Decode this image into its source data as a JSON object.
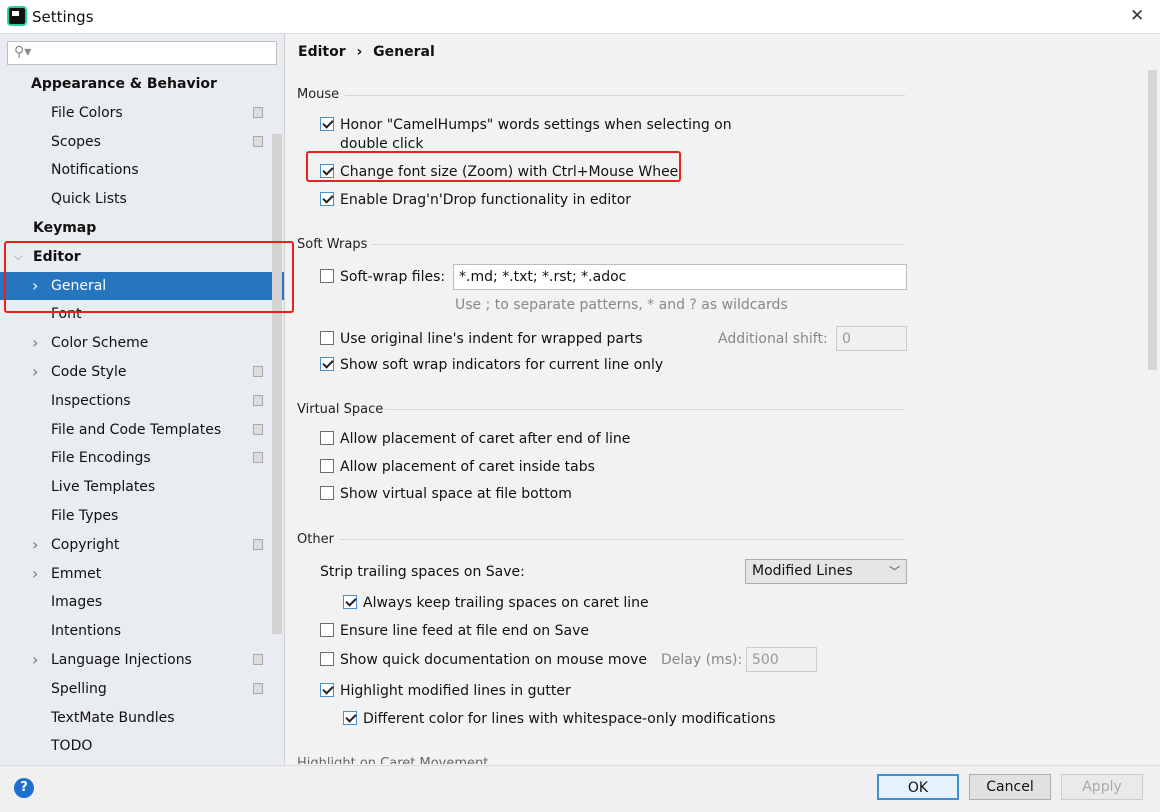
{
  "window": {
    "title": "Settings",
    "close_label": "✕"
  },
  "search": {
    "placeholder": ""
  },
  "sidebar": {
    "items": [
      {
        "label": "Appearance & Behavior",
        "level": 0,
        "bold": true
      },
      {
        "label": "File Colors",
        "level": 1,
        "copy": true
      },
      {
        "label": "Scopes",
        "level": 1,
        "copy": true
      },
      {
        "label": "Notifications",
        "level": 1
      },
      {
        "label": "Quick Lists",
        "level": 1
      },
      {
        "label": "Keymap",
        "level": 0,
        "bold": true
      },
      {
        "label": "Editor",
        "level": 0,
        "bold": true,
        "expanded": true
      },
      {
        "label": "General",
        "level": 1,
        "selected": true,
        "chevron": true
      },
      {
        "label": "Font",
        "level": 1
      },
      {
        "label": "Color Scheme",
        "level": 1,
        "chevron": true
      },
      {
        "label": "Code Style",
        "level": 1,
        "chevron": true,
        "copy": true
      },
      {
        "label": "Inspections",
        "level": 1,
        "copy": true
      },
      {
        "label": "File and Code Templates",
        "level": 1,
        "copy": true
      },
      {
        "label": "File Encodings",
        "level": 1,
        "copy": true
      },
      {
        "label": "Live Templates",
        "level": 1
      },
      {
        "label": "File Types",
        "level": 1
      },
      {
        "label": "Copyright",
        "level": 1,
        "chevron": true,
        "copy": true
      },
      {
        "label": "Emmet",
        "level": 1,
        "chevron": true
      },
      {
        "label": "Images",
        "level": 1
      },
      {
        "label": "Intentions",
        "level": 1
      },
      {
        "label": "Language Injections",
        "level": 1,
        "chevron": true,
        "copy": true
      },
      {
        "label": "Spelling",
        "level": 1,
        "copy": true
      },
      {
        "label": "TextMate Bundles",
        "level": 1
      },
      {
        "label": "TODO",
        "level": 1
      }
    ]
  },
  "breadcrumb": {
    "parent": "Editor",
    "separator": "›",
    "current": "General"
  },
  "mouse": {
    "title": "Mouse",
    "camelhumps": {
      "label": "Honor \"CamelHumps\" words settings when selecting on",
      "label2": "double click",
      "checked": true
    },
    "zoom": {
      "label": "Change font size (Zoom) with Ctrl+Mouse Wheel",
      "checked": true
    },
    "dnd": {
      "label": "Enable Drag'n'Drop functionality in editor",
      "checked": true
    }
  },
  "soft_wraps": {
    "title": "Soft Wraps",
    "files": {
      "label": "Soft-wrap files:",
      "value": "*.md; *.txt; *.rst; *.adoc",
      "checked": false,
      "hint": "Use ; to separate patterns, * and ? as wildcards"
    },
    "indent": {
      "label": "Use original line's indent for wrapped parts",
      "checked": false,
      "shift_label": "Additional shift:",
      "shift_value": "0"
    },
    "indicators": {
      "label": "Show soft wrap indicators for current line only",
      "checked": true
    }
  },
  "virtual_space": {
    "title": "Virtual Space",
    "after_end": {
      "label": "Allow placement of caret after end of line",
      "checked": false
    },
    "inside_tabs": {
      "label": "Allow placement of caret inside tabs",
      "checked": false
    },
    "bottom": {
      "label": "Show virtual space at file bottom",
      "checked": false
    }
  },
  "other": {
    "title": "Other",
    "strip": {
      "label": "Strip trailing spaces on Save:",
      "value": "Modified Lines"
    },
    "keep": {
      "label": "Always keep trailing spaces on caret line",
      "checked": true
    },
    "linefeed": {
      "label": "Ensure line feed at file end on Save",
      "checked": false
    },
    "quickdoc": {
      "label": "Show quick documentation on mouse move",
      "checked": false,
      "delay_label": "Delay (ms):",
      "delay_value": "500"
    },
    "highlight": {
      "label": "Highlight modified lines in gutter",
      "checked": true
    },
    "whitespace": {
      "label": "Different color for lines with whitespace-only modifications",
      "checked": true
    }
  },
  "next_section": {
    "title": "Highlight on Caret Movement"
  },
  "footer": {
    "help": "?",
    "ok": "OK",
    "cancel": "Cancel",
    "apply": "Apply"
  },
  "colors": {
    "selection": "#2675bf",
    "annotation": "#e8211b",
    "sidebar": "#e9ecf0"
  }
}
